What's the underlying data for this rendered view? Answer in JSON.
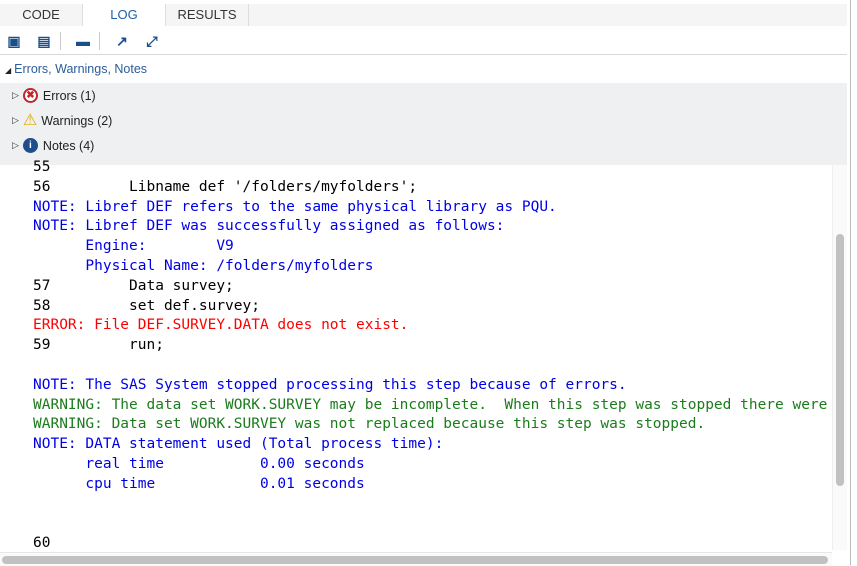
{
  "tabs": [
    {
      "label": "CODE"
    },
    {
      "label": "LOG",
      "active": true
    },
    {
      "label": "RESULTS"
    }
  ],
  "toolbar": {
    "icons": [
      "save-log-icon",
      "download-log-icon",
      "print-icon",
      "popout-icon",
      "maximize-icon"
    ]
  },
  "summary": {
    "title": "Errors, Warnings, Notes",
    "items": [
      {
        "label": "Errors (1)",
        "icon": "error-icon"
      },
      {
        "label": "Warnings (2)",
        "icon": "warning-icon"
      },
      {
        "label": "Notes (4)",
        "icon": "info-icon"
      }
    ]
  },
  "colors": {
    "note": "#0000e6",
    "error": "#ff0000",
    "warning": "#1c7c1c",
    "accent": "#1f5fa8"
  },
  "log": [
    {
      "type": "source",
      "text": "55"
    },
    {
      "type": "source",
      "text": "56         Libname def '/folders/myfolders';"
    },
    {
      "type": "note",
      "text": "NOTE: Libref DEF refers to the same physical library as PQU."
    },
    {
      "type": "note",
      "text": "NOTE: Libref DEF was successfully assigned as follows:"
    },
    {
      "type": "note",
      "text": "      Engine:        V9"
    },
    {
      "type": "note",
      "text": "      Physical Name: /folders/myfolders"
    },
    {
      "type": "source",
      "text": "57         Data survey;"
    },
    {
      "type": "source",
      "text": "58         set def.survey;"
    },
    {
      "type": "error",
      "text": "ERROR: File DEF.SURVEY.DATA does not exist."
    },
    {
      "type": "source",
      "text": "59         run;"
    },
    {
      "type": "source",
      "text": " "
    },
    {
      "type": "note",
      "text": "NOTE: The SAS System stopped processing this step because of errors."
    },
    {
      "type": "warning",
      "text": "WARNING: The data set WORK.SURVEY may be incomplete.  When this step was stopped there were"
    },
    {
      "type": "warning",
      "text": "WARNING: Data set WORK.SURVEY was not replaced because this step was stopped."
    },
    {
      "type": "note",
      "text": "NOTE: DATA statement used (Total process time):"
    },
    {
      "type": "note",
      "text": "      real time           0.00 seconds"
    },
    {
      "type": "note",
      "text": "      cpu time            0.01 seconds"
    },
    {
      "type": "source",
      "text": " "
    },
    {
      "type": "source",
      "text": " "
    },
    {
      "type": "source",
      "text": "60"
    }
  ]
}
